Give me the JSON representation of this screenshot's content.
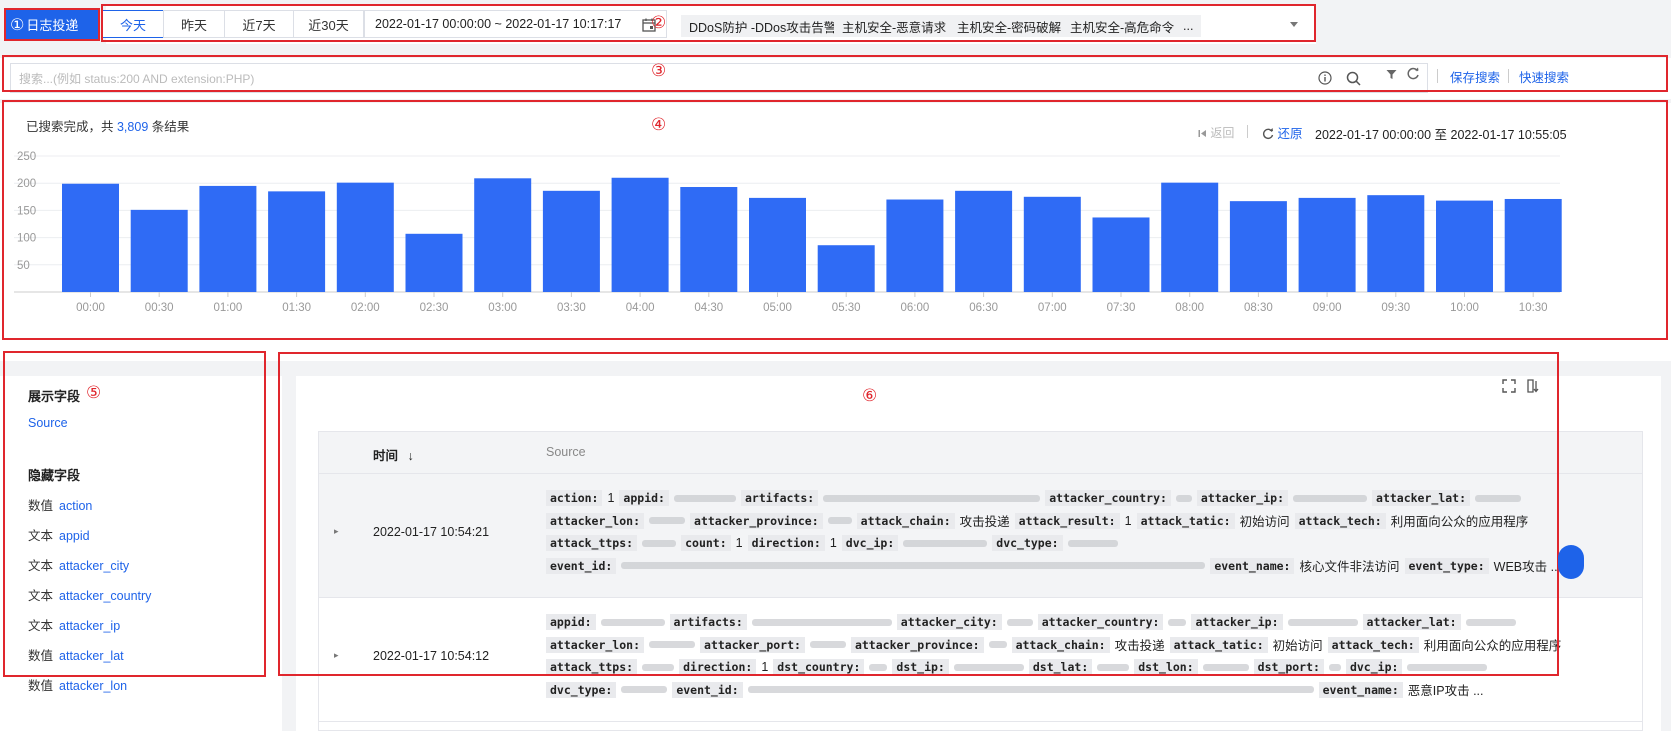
{
  "toolbar": {
    "log_button": "日志投递",
    "annotations": [
      "①",
      "②",
      "③",
      "④",
      "⑤",
      "⑥"
    ],
    "quick_ranges": [
      "今天",
      "昨天",
      "近7天",
      "近30天"
    ],
    "date_range": "2022-01-17 00:00:00 ~ 2022-01-17 10:17:17",
    "tags": [
      "DDoS防护 -DDos攻击告警",
      "主机安全-恶意请求",
      "主机安全-密码破解",
      "主机安全-高危命令",
      "..."
    ]
  },
  "search": {
    "placeholder": "搜索...(例如 status:200 AND extension:PHP)",
    "save_label": "保存搜索",
    "quick_label": "快速搜索"
  },
  "summary": {
    "prefix": "已搜索完成，共 ",
    "count": "3,809",
    "suffix": " 条结果",
    "back_label": "返回",
    "restore_label": "还原",
    "range_text": "2022-01-17 00:00:00 至 2022-01-17 10:55:05"
  },
  "chart_data": {
    "type": "bar",
    "categories": [
      "00:00",
      "00:30",
      "01:00",
      "01:30",
      "02:00",
      "02:30",
      "03:00",
      "03:30",
      "04:00",
      "04:30",
      "05:00",
      "05:30",
      "06:00",
      "06:30",
      "07:00",
      "07:30",
      "08:00",
      "08:30",
      "09:00",
      "09:30",
      "10:00",
      "10:30"
    ],
    "values": [
      199,
      151,
      195,
      185,
      201,
      107,
      209,
      186,
      210,
      193,
      173,
      86,
      170,
      186,
      175,
      137,
      201,
      167,
      173,
      178,
      168,
      171
    ],
    "yticks": [
      50,
      100,
      150,
      200,
      250
    ],
    "ylim": [
      0,
      250
    ],
    "color": "#2f6bf5"
  },
  "fields": {
    "shown_title": "展示字段",
    "shown": [
      "Source"
    ],
    "hidden_title": "隐藏字段",
    "hidden": [
      {
        "type": "数值",
        "name": "action"
      },
      {
        "type": "文本",
        "name": "appid"
      },
      {
        "type": "文本",
        "name": "attacker_city"
      },
      {
        "type": "文本",
        "name": "attacker_country"
      },
      {
        "type": "文本",
        "name": "attacker_ip"
      },
      {
        "type": "数值",
        "name": "attacker_lat"
      },
      {
        "type": "数值",
        "name": "attacker_lon"
      }
    ]
  },
  "table": {
    "col_time": "时间",
    "sort_arrow": "↓",
    "col_source": "Source",
    "rows": [
      {
        "time": "2022-01-17 10:54:21",
        "lines": [
          [
            [
              "action:",
              "1"
            ],
            [
              "appid:",
              "#62"
            ],
            [
              "artifacts:",
              "#217"
            ],
            [
              "attacker_country:",
              "#16"
            ],
            [
              "attacker_ip:",
              "#74"
            ],
            [
              "attacker_lat:",
              "#46"
            ]
          ],
          [
            [
              "attacker_lon:",
              "#36"
            ],
            [
              "attacker_province:",
              "#24"
            ],
            [
              "attack_chain:",
              "攻击投递"
            ],
            [
              "attack_result:",
              "1"
            ],
            [
              "attack_tatic:",
              "初始访问"
            ],
            [
              "attack_tech:",
              "利用面向公众的应用程序"
            ]
          ],
          [
            [
              "attack_ttps:",
              "#34"
            ],
            [
              "count:",
              "1"
            ],
            [
              "direction:",
              "1"
            ],
            [
              "dvc_ip:",
              "#84"
            ],
            [
              "dvc_type:",
              "#50"
            ]
          ],
          [
            [
              "event_id:",
              "#584"
            ],
            [
              "event_name:",
              "核心文件非法访问"
            ],
            [
              "event_type:",
              "WEB攻击 ..."
            ]
          ]
        ]
      },
      {
        "time": "2022-01-17 10:54:12",
        "lines": [
          [
            [
              "appid:",
              "#64"
            ],
            [
              "artifacts:",
              "#140"
            ],
            [
              "attacker_city:",
              "#26"
            ],
            [
              "attacker_country:",
              "#18"
            ],
            [
              "attacker_ip:",
              "#70"
            ],
            [
              "attacker_lat:",
              "#50"
            ]
          ],
          [
            [
              "attacker_lon:",
              "#46"
            ],
            [
              "attacker_port:",
              "#36"
            ],
            [
              "attacker_province:",
              "#18"
            ],
            [
              "attack_chain:",
              "攻击投递"
            ],
            [
              "attack_tatic:",
              "初始访问"
            ],
            [
              "attack_tech:",
              "利用面向公众的应用程序"
            ]
          ],
          [
            [
              "attack_ttps:",
              "#32"
            ],
            [
              "direction:",
              "1"
            ],
            [
              "dst_country:",
              "#18"
            ],
            [
              "dst_ip:",
              "#70"
            ],
            [
              "dst_lat:",
              "#32"
            ],
            [
              "dst_lon:",
              "#46"
            ],
            [
              "dst_port:",
              "#12"
            ],
            [
              "dvc_ip:",
              "#80"
            ]
          ],
          [
            [
              "dvc_type:",
              "#46"
            ],
            [
              "event_id:",
              "#566"
            ],
            [
              "event_name:",
              "恶意IP攻击 ..."
            ]
          ]
        ]
      }
    ]
  }
}
